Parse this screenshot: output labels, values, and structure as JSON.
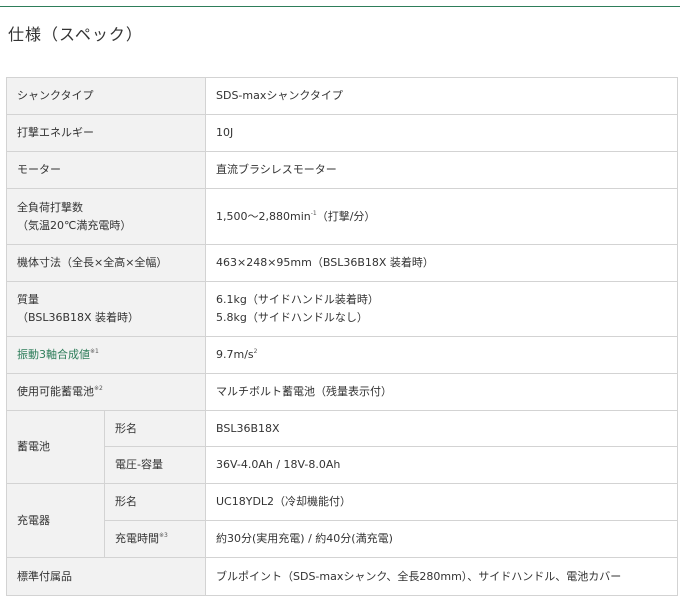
{
  "page": {
    "heading": "仕様（スペック）"
  },
  "specs": {
    "shank": {
      "label": "シャンクタイプ",
      "value": "SDS-maxシャンクタイプ"
    },
    "impact_energy": {
      "label": "打撃エネルギー",
      "value": "10J"
    },
    "motor": {
      "label": "モーター",
      "value": "直流ブラシレスモーター"
    },
    "blows": {
      "label_line1": "全負荷打撃数",
      "label_line2": "（気温20℃満充電時）",
      "value_main": "1,500〜2,880min",
      "value_sup": "-1",
      "value_suffix": "（打撃/分）"
    },
    "dimensions": {
      "label": "機体寸法（全長×全高×全幅）",
      "value": "463×248×95mm（BSL36B18X 装着時）"
    },
    "weight": {
      "label_line1": "質量",
      "label_line2": "（BSL36B18X 装着時）",
      "value_line1": "6.1kg（サイドハンドル装着時）",
      "value_line2": "5.8kg（サイドハンドルなし）"
    },
    "vibration": {
      "label": "振動3軸合成値",
      "label_sup": "※1",
      "value_main": "9.7m/s",
      "value_sup": "2"
    },
    "battery_compat": {
      "label": "使用可能蓄電池",
      "label_sup": "※2",
      "value": "マルチボルト蓄電池（残量表示付）"
    },
    "battery": {
      "label": "蓄電池",
      "model_label": "形名",
      "model_value": "BSL36B18X",
      "voltage_label": "電圧-容量",
      "voltage_value": "36V-4.0Ah / 18V-8.0Ah"
    },
    "charger": {
      "label": "充電器",
      "model_label": "形名",
      "model_value": "UC18YDL2（冷却機能付）",
      "time_label": "充電時間",
      "time_sup": "※3",
      "time_value": "約30分(実用充電) / 約40分(満充電)"
    },
    "accessories": {
      "label": "標準付属品",
      "value": "ブルポイント（SDS-maxシャンク、全長280mm）、サイドハンドル、電池カバー"
    }
  },
  "colors": {
    "accent": "#2e7d5a",
    "label_bg": "#f2f2f2",
    "border": "#d3d3d3"
  }
}
